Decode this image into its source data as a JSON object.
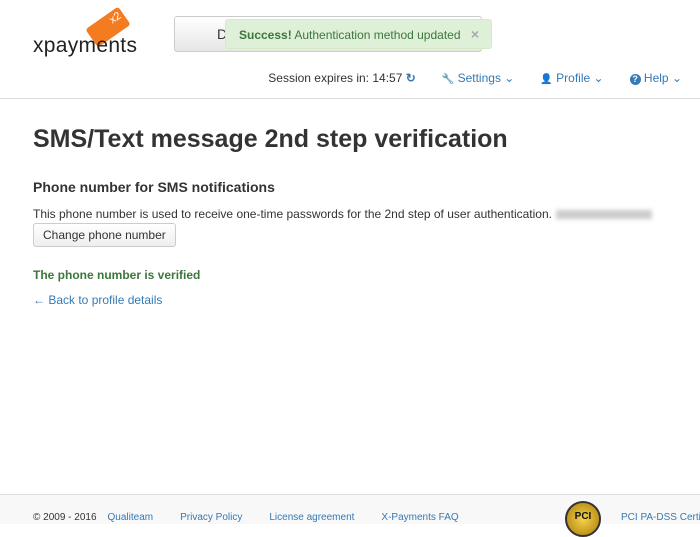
{
  "header": {
    "logo_text": "xpayments",
    "logo_badge": "x2",
    "bg_button_label": "D",
    "alert": {
      "strong": "Success!",
      "message": " Authentication method updated",
      "close": "×"
    },
    "session_label": "Session expires in: ",
    "session_time": "14:57",
    "refresh_icon": "↻",
    "nav": [
      {
        "icon": "🔧",
        "label": "Settings"
      },
      {
        "icon": "👤",
        "label": "Profile"
      },
      {
        "icon": "?",
        "label": "Help"
      }
    ]
  },
  "main": {
    "title": "SMS/Text message 2nd step verification",
    "subtitle": "Phone number for SMS notifications",
    "description": "This phone number is used to receive one-time passwords for the 2nd step of user authentication.",
    "change_button": "Change phone number",
    "verified": "The phone number is verified",
    "back_link": "← Back to profile details"
  },
  "footer": {
    "copyright": "© 2009 - 2016",
    "links": [
      "Qualiteam",
      "Privacy Policy",
      "License agreement",
      "X-Payments FAQ"
    ],
    "pci_badge": "PCI",
    "pci_text": "PCI PA-DSS Certified"
  }
}
